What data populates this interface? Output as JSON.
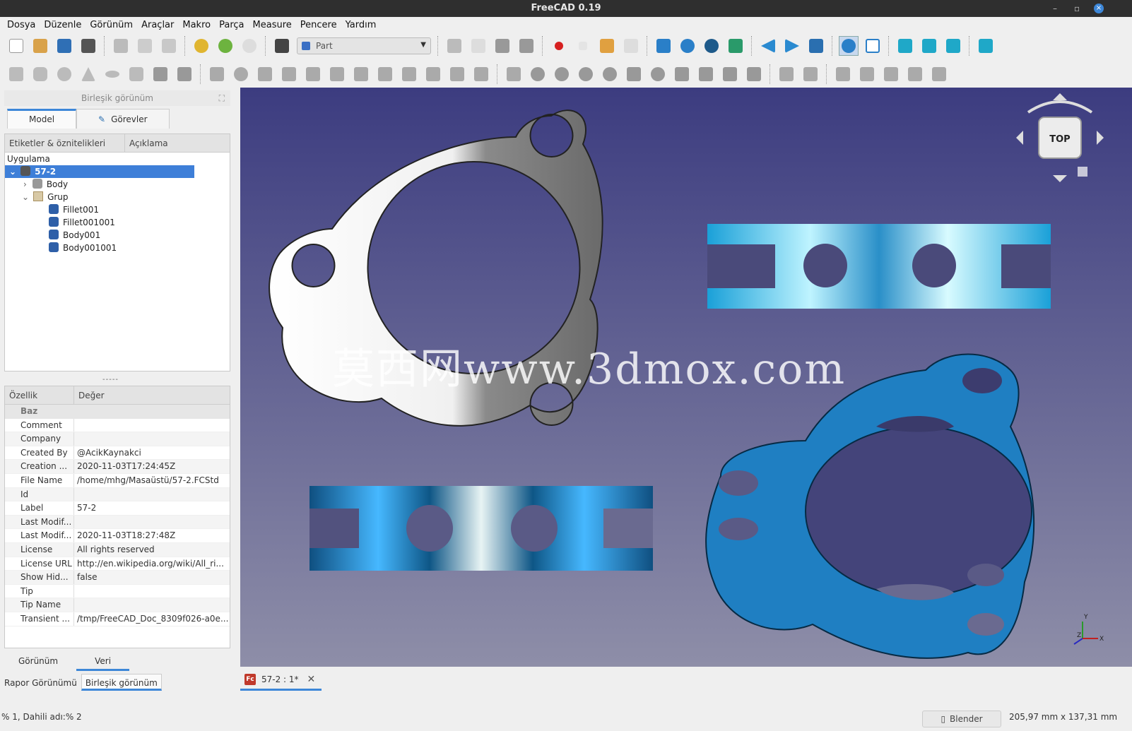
{
  "window": {
    "title": "FreeCAD 0.19"
  },
  "menu": [
    "Dosya",
    "Düzenle",
    "Görünüm",
    "Araçlar",
    "Makro",
    "Parça",
    "Measure",
    "Pencere",
    "Yardım"
  ],
  "workbench": {
    "selected": "Part"
  },
  "combo_view": {
    "title": "Birleşik görünüm",
    "tabs": [
      "Model",
      "Görevler"
    ],
    "tree_headers": [
      "Etiketler & öznitelikleri",
      "Açıklama"
    ],
    "tree": {
      "root": "Uygulama",
      "document": "57-2",
      "items": [
        "Body",
        "Grup",
        "Fillet001",
        "Fillet001001",
        "Body001",
        "Body001001"
      ]
    },
    "splitter": "-----",
    "prop_headers": [
      "Özellik",
      "Değer"
    ],
    "prop_group": "Baz",
    "properties": [
      {
        "k": "Comment",
        "v": ""
      },
      {
        "k": "Company",
        "v": ""
      },
      {
        "k": "Created By",
        "v": "@AcikKaynakci"
      },
      {
        "k": "Creation ...",
        "v": "2020-11-03T17:24:45Z"
      },
      {
        "k": "File Name",
        "v": "/home/mhg/Masaüstü/57-2.FCStd"
      },
      {
        "k": "Id",
        "v": ""
      },
      {
        "k": "Label",
        "v": "57-2"
      },
      {
        "k": "Last Modif...",
        "v": ""
      },
      {
        "k": "Last Modif...",
        "v": "2020-11-03T18:27:48Z"
      },
      {
        "k": "License",
        "v": "All rights reserved"
      },
      {
        "k": "License URL",
        "v": "http://en.wikipedia.org/wiki/All_ri..."
      },
      {
        "k": "Show Hid...",
        "v": "false"
      },
      {
        "k": "Tip",
        "v": ""
      },
      {
        "k": "Tip Name",
        "v": ""
      },
      {
        "k": "Transient ...",
        "v": "/tmp/FreeCAD_Doc_8309f026-a0e..."
      }
    ],
    "bottom_tabs": [
      "Görünüm",
      "Veri"
    ],
    "dock_tabs": [
      "Rapor Görünümü",
      "Birleşik görünüm"
    ]
  },
  "viewport": {
    "watermark": "莫西网www.3dmox.com",
    "navcube_face": "TOP",
    "axis_labels": [
      "Y",
      "Z",
      "X"
    ]
  },
  "doc_tab": {
    "label": "57-2 : 1*",
    "icon_text": "Fc"
  },
  "status": {
    "left": "% 1, Dahili adı:% 2",
    "nav_style": "Blender",
    "dimensions": "205,97 mm x 137,31 mm"
  },
  "colors": {
    "accent": "#3d87d8",
    "selection": "#3e7fd8",
    "part_blue": "#1f7fc2",
    "bg_top": "#3c3c80",
    "bg_bottom": "#8e8ea8"
  }
}
